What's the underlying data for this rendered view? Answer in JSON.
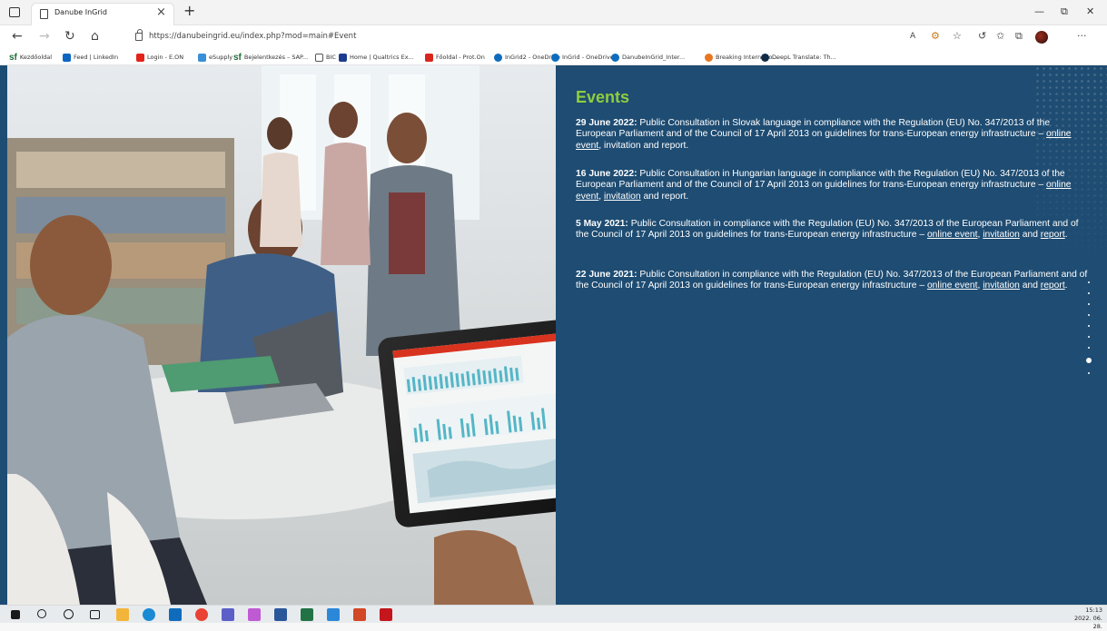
{
  "tabbar": {
    "tab_title": "Danube InGrid",
    "close_glyph": "×",
    "new_tab_glyph": "+",
    "minimize_glyph": "—",
    "restore_glyph": "⧉",
    "close_window_glyph": "✕"
  },
  "addressbar": {
    "back_glyph": "←",
    "forward_glyph": "→",
    "refresh_glyph": "↻",
    "home_glyph": "⌂",
    "url": "https://danubeingrid.eu/index.php?mod=main#Event",
    "read_aloud_glyph": "A",
    "more_glyph": "···"
  },
  "bookmarks": [
    {
      "label": "Kezdőoldal",
      "icon": "sf-icon",
      "color": "#1f6b3a"
    },
    {
      "label": "Feed | LinkedIn",
      "icon": "linkedin-icon",
      "color": "#0a66c2"
    },
    {
      "label": "Login - E.ON",
      "icon": "eon-icon",
      "color": "#e2231a"
    },
    {
      "label": "eSupply",
      "icon": "esupply-icon",
      "color": "#3a8fd8"
    },
    {
      "label": "Bejelentkezés – SAP...",
      "icon": "sf-icon",
      "color": "#1f6b3a"
    },
    {
      "label": "BIC",
      "icon": "page-icon",
      "color": "#ffffff"
    },
    {
      "label": "Home | Qualtrics Ex...",
      "icon": "qualtrics-icon",
      "color": "#1d3c8f"
    },
    {
      "label": "Főoldal - Prot.On",
      "icon": "proton-icon",
      "color": "#d9261c"
    },
    {
      "label": "InGrid2 - OneDrive",
      "icon": "onedrive-icon",
      "color": "#0f6cbd"
    },
    {
      "label": "InGrid - OneDrive",
      "icon": "onedrive-icon",
      "color": "#0f6cbd"
    },
    {
      "label": "DanubeInGrid_Inter...",
      "icon": "onedrive-icon",
      "color": "#0f6cbd"
    },
    {
      "label": "Breaking Internatio...",
      "icon": "news-icon",
      "color": "#e87722"
    },
    {
      "label": "DeepL Translate: Th...",
      "icon": "deepl-icon",
      "color": "#0f2b46"
    }
  ],
  "events": {
    "title": "Events",
    "items": [
      {
        "date": "29 June 2022:",
        "text": "Public Consultation in Slovak language in compliance with the Regulation (EU) No. 347/2013 of the European Parliament and of the Council of 17 April 2013 on guidelines for trans-European energy infrastructure –",
        "link1": "online event",
        "sep1": ",",
        "plain_mid": " invitation and report.",
        "link2": "",
        "sep2": "",
        "link3": "",
        "end": ""
      },
      {
        "date": "16 June 2022:",
        "text": "Public Consultation in Hungarian language in compliance with the Regulation (EU) No. 347/2013 of the European Parliament and of the Council of 17 April 2013 on guidelines for trans-European energy infrastructure –",
        "link1": "online event",
        "sep1": ", ",
        "plain_mid": "",
        "link2": "invitation",
        "sep2": " and report.",
        "link3": "",
        "end": ""
      },
      {
        "date": "5 May 2021:",
        "text": "Public Consultation in compliance with the Regulation (EU) No. 347/2013 of the European Parliament and of the Council of 17 April 2013 on guidelines for trans-European energy infrastructure –",
        "link1": "online event",
        "sep1": ", ",
        "plain_mid": "",
        "link2": "invitation",
        "sep2": " and ",
        "link3": "report",
        "end": "."
      },
      {
        "date": "22 June 2021:",
        "text": "Public Consultation in compliance with the Regulation (EU) No. 347/2013 of the European Parliament and of the Council of 17 April 2013 on guidelines for trans-European energy infrastructure –",
        "link1": "online event",
        "sep1": ", ",
        "plain_mid": "",
        "link2": "invitation",
        "sep2": " and ",
        "link3": "report",
        "end": "."
      }
    ]
  },
  "taskbar": {
    "time": "15:13",
    "date": "2022. 06. 28.",
    "apps": [
      {
        "icon": "windows-start-icon",
        "color": "#1a1a1a"
      },
      {
        "icon": "search-icon",
        "color": "#1a1a1a"
      },
      {
        "icon": "cortana-icon",
        "color": "#1a1a1a"
      },
      {
        "icon": "task-view-icon",
        "color": "#1a1a1a"
      },
      {
        "icon": "file-explorer-icon",
        "color": "#f2b53a"
      },
      {
        "icon": "edge-icon",
        "color": "#1a8ad4"
      },
      {
        "icon": "outlook-icon",
        "color": "#0f6cbd"
      },
      {
        "icon": "chrome-icon",
        "color": "#e94235"
      },
      {
        "icon": "teams-icon",
        "color": "#5b5fc7"
      },
      {
        "icon": "snipping-icon",
        "color": "#c05ad2"
      },
      {
        "icon": "word-icon",
        "color": "#2b579a"
      },
      {
        "icon": "excel-icon",
        "color": "#217346"
      },
      {
        "icon": "sticky-notes-icon",
        "color": "#2b88d8"
      },
      {
        "icon": "powerpoint-icon",
        "color": "#d24726"
      },
      {
        "icon": "acrobat-icon",
        "color": "#c4161c"
      }
    ]
  }
}
